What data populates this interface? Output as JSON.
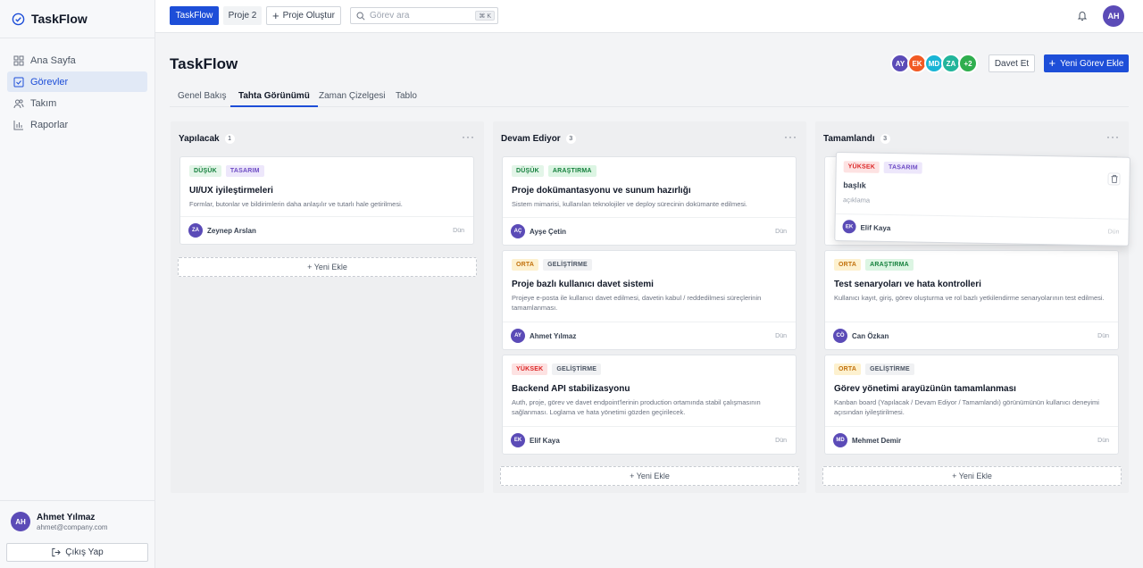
{
  "app": {
    "name": "TaskFlow"
  },
  "sidebar": {
    "items": [
      {
        "label": "Ana Sayfa",
        "icon": "grid-icon",
        "active": false
      },
      {
        "label": "Görevler",
        "icon": "checkbox-icon",
        "active": true
      },
      {
        "label": "Takım",
        "icon": "users-icon",
        "active": false
      },
      {
        "label": "Raporlar",
        "icon": "bar-chart-icon",
        "active": false
      }
    ],
    "user": {
      "initials": "AH",
      "name": "Ahmet Yılmaz",
      "email": "ahmet@company.com"
    },
    "logout_label": "Çıkış Yap"
  },
  "topbar": {
    "project_active": "TaskFlow",
    "project_other": "Proje 2",
    "create_project": "Proje Oluştur",
    "search_placeholder": "Görev ara",
    "search_shortcut": "⌘ K",
    "avatar_initials": "AH"
  },
  "header": {
    "title": "TaskFlow",
    "members": [
      {
        "initials": "AY",
        "color": "#5b4bb7"
      },
      {
        "initials": "EK",
        "color": "#f15a24"
      },
      {
        "initials": "MD",
        "color": "#19b5d6"
      },
      {
        "initials": "ZA",
        "color": "#22b59b"
      },
      {
        "initials": "+2",
        "color": "#2fae4e"
      }
    ],
    "invite_label": "Davet Et",
    "new_task_label": "Yeni Görev Ekle"
  },
  "tabs": [
    {
      "label": "Genel Bakış",
      "active": false
    },
    {
      "label": "Tahta Görünümü",
      "active": true
    },
    {
      "label": "Zaman Çizelgesi",
      "active": false
    },
    {
      "label": "Tablo",
      "active": false
    }
  ],
  "add_label": "+ Yeni Ekle",
  "columns": [
    {
      "title": "Yapılacak",
      "count": "1",
      "cards": [
        {
          "tags": [
            {
              "text": "DÜŞÜK",
              "kind": "low"
            },
            {
              "text": "TASARIM",
              "kind": "design"
            }
          ],
          "title": "UI/UX iyileştirmeleri",
          "desc": "Formlar, butonlar ve bildirimlerin daha anlaşılır ve tutarlı hale getirilmesi.",
          "avatar": "ZA",
          "assignee": "Zeynep Arslan",
          "date": "Dün"
        }
      ]
    },
    {
      "title": "Devam Ediyor",
      "count": "3",
      "cards": [
        {
          "tags": [
            {
              "text": "DÜŞÜK",
              "kind": "low"
            },
            {
              "text": "ARAŞTIRMA",
              "kind": "research"
            }
          ],
          "title": "Proje dokümantasyonu ve sunum hazırlığı",
          "desc": "Sistem mimarisi, kullanılan teknolojiler ve deploy sürecinin dokümante edilmesi.",
          "avatar": "AÇ",
          "assignee": "Ayşe Çetin",
          "date": "Dün"
        },
        {
          "tags": [
            {
              "text": "ORTA",
              "kind": "medium"
            },
            {
              "text": "GELİŞTİRME",
              "kind": "dev"
            }
          ],
          "title": "Proje bazlı kullanıcı davet sistemi",
          "desc": "Projeye e-posta ile kullanıcı davet edilmesi, davetin kabul / reddedilmesi süreçlerinin tamamlanması.",
          "avatar": "AY",
          "assignee": "Ahmet Yılmaz",
          "date": "Dün"
        },
        {
          "tags": [
            {
              "text": "YÜKSEK",
              "kind": "high"
            },
            {
              "text": "GELİŞTİRME",
              "kind": "dev"
            }
          ],
          "title": "Backend API stabilizasyonu",
          "desc": "Auth, proje, görev ve davet endpoint'lerinin production ortamında stabil çalışmasının sağlanması. Loglama ve hata yönetimi gözden geçirilecek.",
          "avatar": "EK",
          "assignee": "Elif Kaya",
          "date": "Dün"
        }
      ]
    },
    {
      "title": "Tamamlandı",
      "count": "3",
      "cards": [
        {
          "tags": [],
          "title": "",
          "desc": "",
          "avatar": "",
          "assignee": "",
          "date": ""
        },
        {
          "tags": [
            {
              "text": "ORTA",
              "kind": "medium"
            },
            {
              "text": "ARAŞTIRMA",
              "kind": "research"
            }
          ],
          "title": "Test senaryoları ve hata kontrolleri",
          "desc": "Kullanıcı kayıt, giriş, görev oluşturma ve rol bazlı yetkilendirme senaryolarının test edilmesi.",
          "avatar": "CÖ",
          "assignee": "Can Özkan",
          "date": "Dün"
        },
        {
          "tags": [
            {
              "text": "ORTA",
              "kind": "medium"
            },
            {
              "text": "GELİŞTİRME",
              "kind": "dev"
            }
          ],
          "title": "Görev yönetimi arayüzünün tamamlanması",
          "desc": "Kanban board (Yapılacak / Devam Ediyor / Tamamlandı) görünümünün kullanıcı deneyimi açısından iyileştirilmesi.",
          "avatar": "MD",
          "assignee": "Mehmet Demir",
          "date": "Dün"
        }
      ]
    }
  ],
  "dragged_card": {
    "tags": [
      {
        "text": "YÜKSEK",
        "kind": "high"
      },
      {
        "text": "TASARIM",
        "kind": "design"
      }
    ],
    "title": "başlık",
    "desc": "açıklama",
    "avatar": "EK",
    "assignee": "Elif Kaya",
    "date": "Dün"
  },
  "tag_colors": {
    "low": {
      "bg": "#e3f5e8",
      "fg": "#15803d"
    },
    "design": {
      "bg": "#ede7fb",
      "fg": "#6d4bc4"
    },
    "research": {
      "bg": "#dcf5e3",
      "fg": "#15803d"
    },
    "medium": {
      "bg": "#fdf1cf",
      "fg": "#c2710c"
    },
    "dev": {
      "bg": "#f0f1f3",
      "fg": "#4b5563"
    },
    "high": {
      "bg": "#fde2e2",
      "fg": "#dc2626"
    }
  }
}
